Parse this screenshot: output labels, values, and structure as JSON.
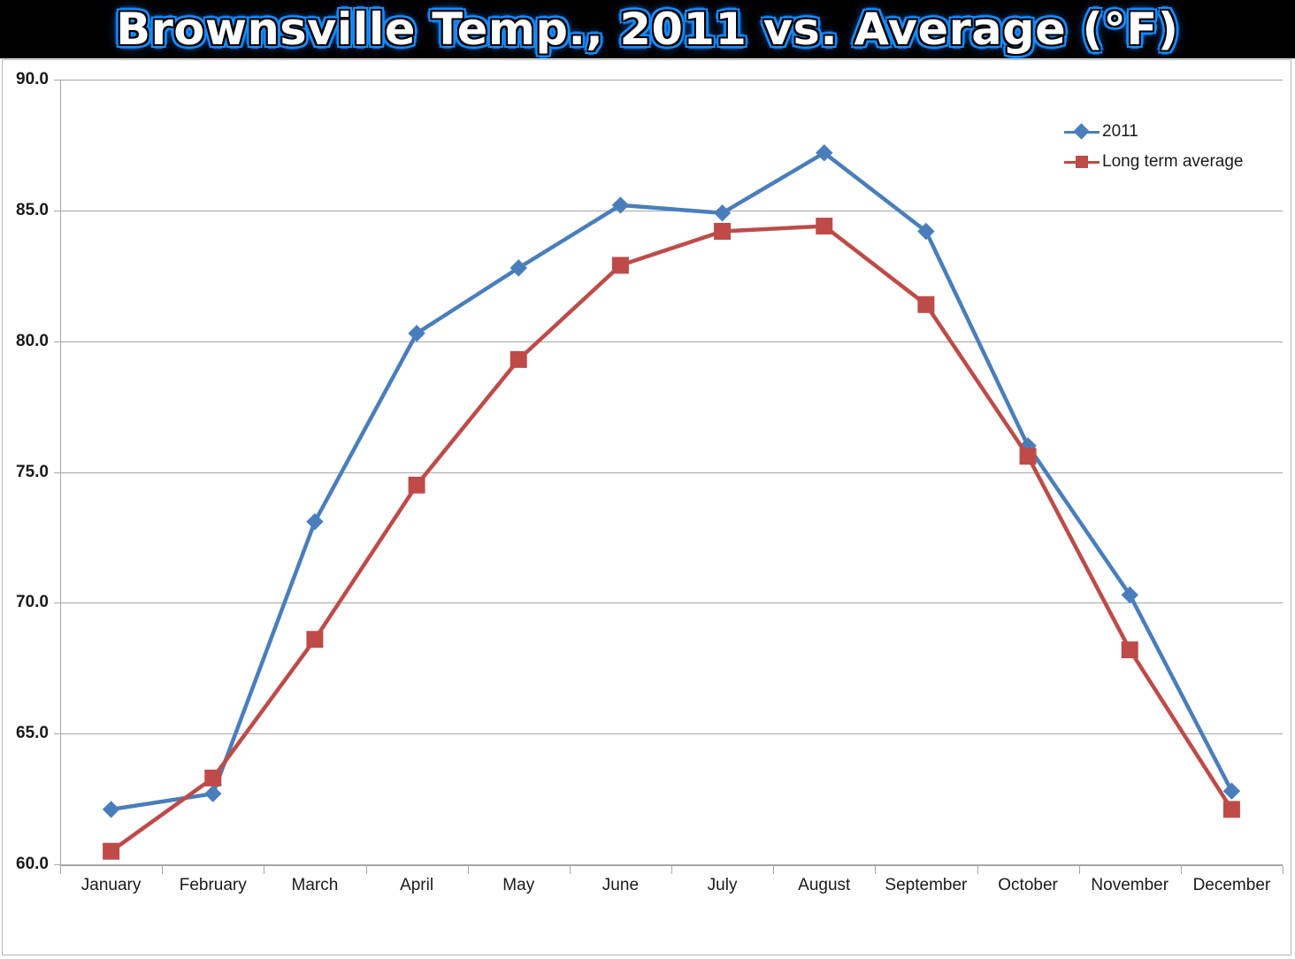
{
  "title": "Brownsville Temp., 2011 vs. Average (°F)",
  "title_colors": {
    "background": "#000000",
    "fill": "#ffffff",
    "outline": "#000000",
    "glow": "#0080ff"
  },
  "legend": {
    "position": "top-right",
    "entries": [
      {
        "label": "2011",
        "color": "#4a7ebb",
        "marker": "diamond"
      },
      {
        "label": "Long term average",
        "color": "#be4b48",
        "marker": "square"
      }
    ]
  },
  "axes": {
    "y_ticks": [
      "90.0",
      "85.0",
      "80.0",
      "75.0",
      "70.0",
      "65.0",
      "60.0"
    ],
    "x_ticks": [
      "January",
      "February",
      "March",
      "April",
      "May",
      "June",
      "July",
      "August",
      "September",
      "October",
      "November",
      "December"
    ]
  },
  "chart_data": {
    "type": "line",
    "title": "Brownsville Temp., 2011 vs. Average (°F)",
    "xlabel": "",
    "ylabel": "",
    "ylim": [
      60.0,
      90.0
    ],
    "ytick_step": 5.0,
    "grid": true,
    "legend_position": "top-right",
    "categories": [
      "January",
      "February",
      "March",
      "April",
      "May",
      "June",
      "July",
      "August",
      "September",
      "October",
      "November",
      "December"
    ],
    "series": [
      {
        "name": "2011",
        "color": "#4a7ebb",
        "marker": "diamond",
        "values": [
          62.1,
          62.7,
          73.1,
          80.3,
          82.8,
          85.2,
          84.9,
          87.2,
          84.2,
          76.0,
          70.3,
          62.8
        ]
      },
      {
        "name": "Long term average",
        "color": "#be4b48",
        "marker": "square",
        "values": [
          60.5,
          63.3,
          68.6,
          74.5,
          79.3,
          82.9,
          84.2,
          84.4,
          81.4,
          75.6,
          68.2,
          62.1
        ]
      }
    ]
  }
}
